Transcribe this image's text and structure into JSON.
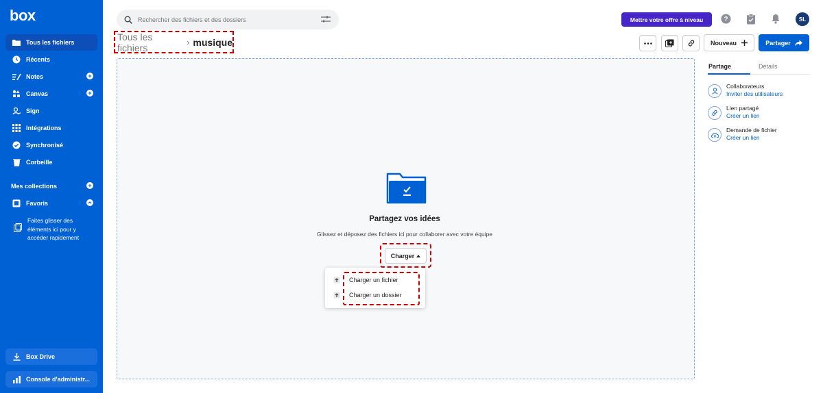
{
  "brand": {
    "logo": "box",
    "accent": "#0061d5",
    "upgrade_color": "#4626c7"
  },
  "sidebar": {
    "items": [
      {
        "label": "Tous les fichiers",
        "icon": "folder-icon",
        "active": true
      },
      {
        "label": "Récents",
        "icon": "clock-icon"
      },
      {
        "label": "Notes",
        "icon": "notes-icon",
        "has_add": true
      },
      {
        "label": "Canvas",
        "icon": "canvas-icon",
        "has_add": true
      },
      {
        "label": "Sign",
        "icon": "sign-icon"
      },
      {
        "label": "Intégrations",
        "icon": "grid-icon"
      },
      {
        "label": "Synchronisé",
        "icon": "check-circle-icon"
      },
      {
        "label": "Corbeille",
        "icon": "trash-icon"
      }
    ],
    "collections_label": "Mes collections",
    "favorites_label": "Favoris",
    "drop_hint": "Faites glisser des éléments ici pour y accéder rapidement",
    "box_drive": "Box Drive",
    "admin_console": "Console d'administr..."
  },
  "header": {
    "search_placeholder": "Rechercher des fichiers et des dossiers",
    "upgrade_label": "Mettre votre offre à niveau",
    "avatar_initials": "SL"
  },
  "breadcrumb": {
    "root": "Tous les fichiers",
    "current": "musique"
  },
  "toolbar": {
    "new_label": "Nouveau",
    "share_label": "Partager"
  },
  "dropzone": {
    "title": "Partagez vos idées",
    "subtitle": "Glissez et déposez des fichiers ici pour collaborer avec votre équipe",
    "upload_label": "Charger",
    "menu": [
      "Charger un fichier",
      "Charger un dossier"
    ]
  },
  "right_panel": {
    "tabs": [
      "Partage",
      "Détails"
    ],
    "items": [
      {
        "title": "Collaborateurs",
        "action": "Inviter des utilisateurs",
        "icon": "person-icon"
      },
      {
        "title": "Lien partagé",
        "action": "Créer un lien",
        "icon": "link-icon"
      },
      {
        "title": "Demande de fichier",
        "action": "Créer un lien",
        "icon": "cloud-upload-icon"
      }
    ]
  }
}
